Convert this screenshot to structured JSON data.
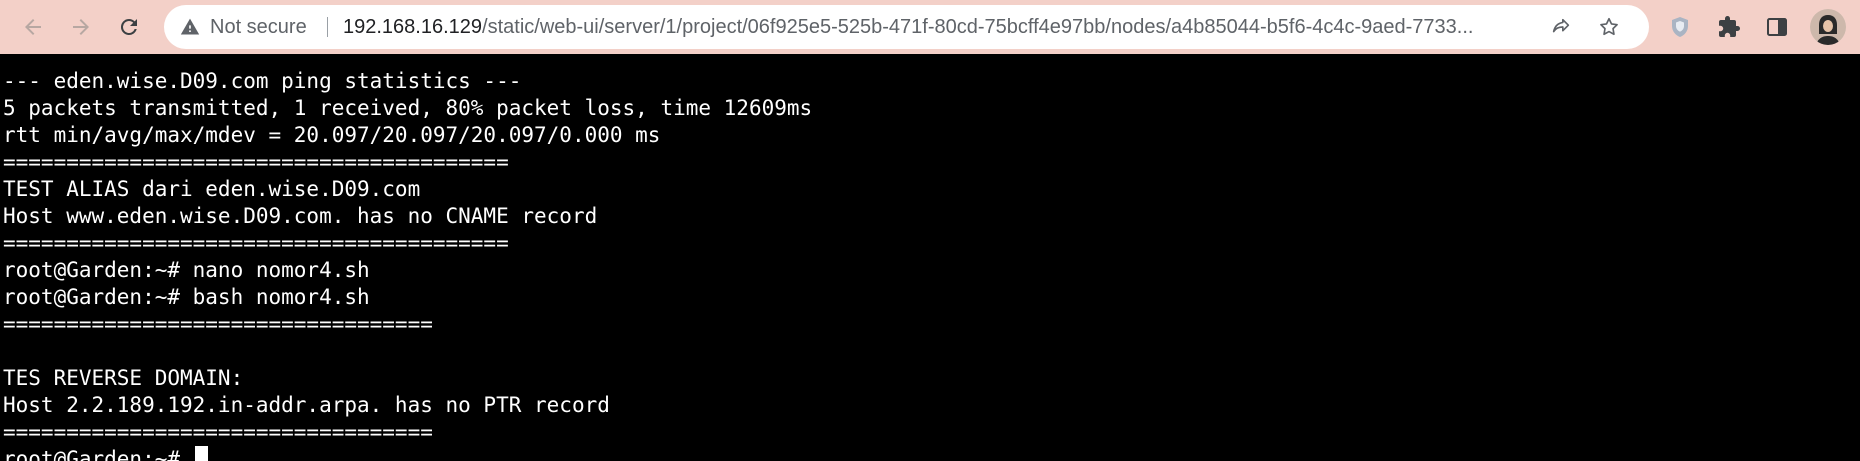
{
  "browser": {
    "security_label": "Not secure",
    "url_host": "192.168.16.129",
    "url_path": "/static/web-ui/server/1/project/06f925e5-525b-471f-80cd-75bcff4e97bb/nodes/a4b85044-b5f6-4c4c-9aed-7733..."
  },
  "terminal": {
    "lines": [
      "--- eden.wise.D09.com ping statistics ---",
      "5 packets transmitted, 1 received, 80% packet loss, time 12609ms",
      "rtt min/avg/max/mdev = 20.097/20.097/20.097/0.000 ms",
      "========================================",
      "TEST ALIAS dari eden.wise.D09.com",
      "Host www.eden.wise.D09.com. has no CNAME record",
      "========================================",
      "root@Garden:~# nano nomor4.sh",
      "root@Garden:~# bash nomor4.sh",
      "==================================",
      "",
      "TES REVERSE DOMAIN:",
      "Host 2.2.189.192.in-addr.arpa. has no PTR record",
      "==================================",
      "root@Garden:~# "
    ]
  }
}
